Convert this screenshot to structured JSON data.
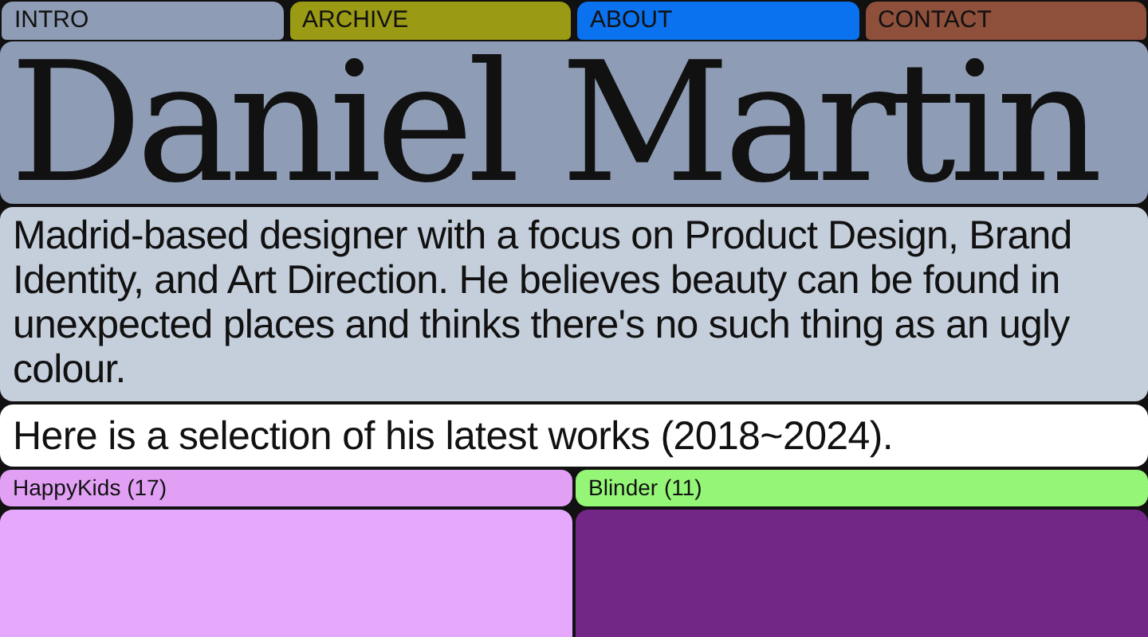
{
  "nav": [
    {
      "label": "INTRO",
      "color": "#8e9db5"
    },
    {
      "label": "ARCHIVE",
      "color": "#9a9a14"
    },
    {
      "label": "ABOUT",
      "color": "#0a72ef"
    },
    {
      "label": "CONTACT",
      "color": "#8e4f3b"
    }
  ],
  "name": "Daniel Martin",
  "bio": "Madrid-based designer with a focus on Product Design, Brand Identity, and Art Direction. He believes beauty can be found in unexpected places and thinks there's no such thing as an ugly colour.",
  "intro": "Here is a selection of his latest works (2018~2024).",
  "projects": [
    {
      "title": "HappyKids (17)",
      "color": "#e2a0f5",
      "cover": {
        "color": "#e6a8fc"
      }
    },
    {
      "title": "Blinder (11)",
      "color": "#94f577",
      "cover": {
        "color": "#722786"
      }
    }
  ]
}
